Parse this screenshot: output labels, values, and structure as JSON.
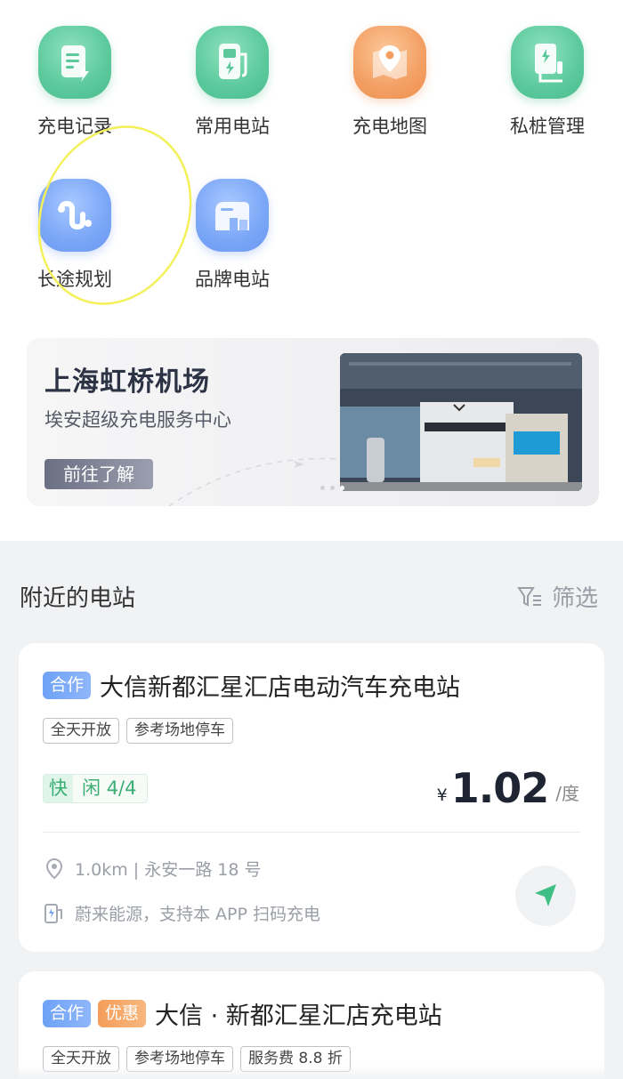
{
  "grid": {
    "charge_record": "充电记录",
    "fav_stations": "常用电站",
    "charge_map": "充电地图",
    "private_pile": "私桩管理",
    "long_trip": "长途规划",
    "brand_station": "品牌电站"
  },
  "banner": {
    "title": "上海虹桥机场",
    "subtitle": "埃安超级充电服务中心",
    "button": "前往了解"
  },
  "nearby": {
    "title": "附近的电站",
    "filter_label": "筛选"
  },
  "stations": [
    {
      "tags": [
        "合作"
      ],
      "name": "大信新都汇星汇店电动汽车充电站",
      "chips": [
        "全天开放",
        "参考场地停车"
      ],
      "fast_label": "快",
      "idle_label": "闲",
      "idle_count": "4/4",
      "currency": "¥",
      "price": "1.02",
      "unit": "/度",
      "distance_address": "1.0km | 永安一路 18 号",
      "operator": "蔚来能源，支持本 APP 扫码充电"
    },
    {
      "tags": [
        "合作",
        "优惠"
      ],
      "name": "大信 · 新都汇星汇店充电站",
      "chips": [
        "全天开放",
        "参考场地停车",
        "服务费 8.8 折"
      ]
    }
  ],
  "colors": {
    "green_icon": "#5bc99c",
    "orange_icon": "#f39f63",
    "blue_icon": "#7aa6f7",
    "available_green": "#3aae73",
    "annotation_yellow": "#f3f05a"
  }
}
